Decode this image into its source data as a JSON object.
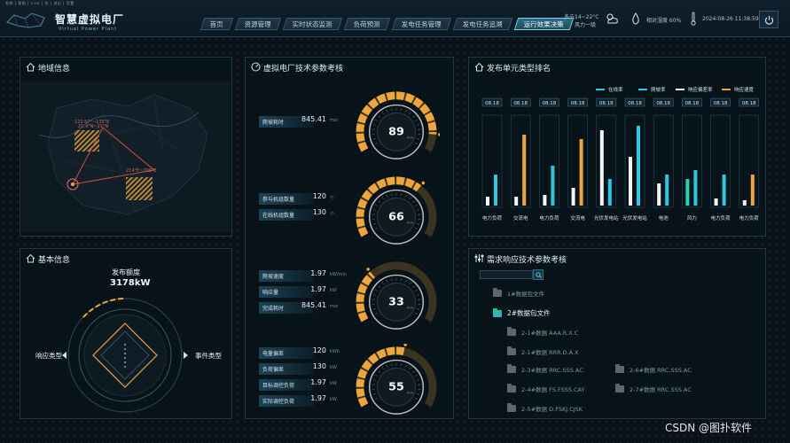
{
  "system_bar": "系统 | 帮助 | Line | 关 | 退出 | 设置",
  "app": {
    "title": "智慧虚拟电厂",
    "subtitle": "Virtual Power Plant"
  },
  "nav": [
    {
      "label": "首页",
      "active": false
    },
    {
      "label": "资源管理",
      "active": false
    },
    {
      "label": "实时状态监测",
      "active": false
    },
    {
      "label": "负荷预测",
      "active": false
    },
    {
      "label": "发电任务管理",
      "active": false
    },
    {
      "label": "发电任务追溯",
      "active": false
    },
    {
      "label": "运行效果决策",
      "active": true
    }
  ],
  "status": {
    "weather_line1": "多云14~22°C",
    "weather_line2": "风力一级",
    "humidity": "相对湿度 60%",
    "datetime": "2024-08-26 11:38:59"
  },
  "map_panel": {
    "title": "地域信息",
    "labels": [
      "121.57°~135°E",
      "21.4°N~25°N",
      "214°E~290°E"
    ]
  },
  "tech_panel": {
    "title": "虚拟电厂技术参数考核",
    "groups": [
      {
        "gauge": 89,
        "unit": "min",
        "fraction": 0.89,
        "rows": [
          {
            "label": "爬坡耗时",
            "value": "845.41",
            "unit": "min"
          }
        ]
      },
      {
        "gauge": 66,
        "unit": "min",
        "fraction": 0.66,
        "rows": [
          {
            "label": "参与机组数量",
            "value": "120",
            "unit": "个"
          },
          {
            "label": "在线机组数量",
            "value": "130",
            "unit": "个"
          }
        ]
      },
      {
        "gauge": 33,
        "unit": "min",
        "fraction": 0.33,
        "rows": [
          {
            "label": "爬坡速度",
            "value": "1.97",
            "unit": "kW/min"
          },
          {
            "label": "响应量",
            "value": "1.97",
            "unit": "kW"
          },
          {
            "label": "完成耗时",
            "value": "845.41",
            "unit": "min"
          }
        ]
      },
      {
        "gauge": 55,
        "unit": "min",
        "fraction": 0.55,
        "rows": [
          {
            "label": "电量偏差",
            "value": "120",
            "unit": "kWh"
          },
          {
            "label": "负荷偏差",
            "value": "130",
            "unit": "kW"
          },
          {
            "label": "目标调控负荷",
            "value": "1.97",
            "unit": "kW"
          },
          {
            "label": "实际调控负荷",
            "value": "1.97",
            "unit": "kW"
          }
        ]
      }
    ]
  },
  "basic_panel": {
    "title": "基本信息",
    "top_label": "发布额度",
    "top_value": "3178kW",
    "left_label": "响应类型",
    "right_label": "事件类型"
  },
  "colors": {
    "cyan": "#2bc8e0",
    "white": "#f2f6f8",
    "orange": "#f0a53c",
    "green": "#2ad3b0"
  },
  "chart_panel": {
    "title": "发布单元类型排名"
  },
  "chart_data": {
    "type": "bar",
    "legend": [
      "在线率",
      "爬坡率",
      "响应偏差率",
      "响应速度"
    ],
    "legend_placement": "top-right",
    "categories": [
      "电力负荷",
      "交流电",
      "电力负荷",
      "交流电",
      "光伏发电站",
      "光伏发电站",
      "电池",
      "风力",
      "电力负荷",
      "电力负荷"
    ],
    "top_labels": [
      "08.18",
      "08.18",
      "08.18",
      "08.18",
      "08.18",
      "08.18",
      "08.18",
      "08.18",
      "08.18",
      "08.18"
    ],
    "ylim": [
      0,
      100
    ],
    "series": [
      {
        "values": [
          10,
          10,
          12,
          20,
          85,
          55,
          25,
          30,
          8,
          6
        ],
        "color_key": "white"
      },
      {
        "values": [
          35,
          80,
          45,
          75,
          30,
          90,
          35,
          40,
          35,
          35
        ],
        "color_key": "cyan"
      }
    ],
    "bar_colors": [
      [
        "white",
        "cyan"
      ],
      [
        "white",
        "orange"
      ],
      [
        "white",
        "cyan"
      ],
      [
        "white",
        "orange"
      ],
      [
        "white",
        "cyan"
      ],
      [
        "white",
        "cyan"
      ],
      [
        "white",
        "cyan"
      ],
      [
        "green",
        "cyan"
      ],
      [
        "white",
        "cyan"
      ],
      [
        "white",
        "orange"
      ]
    ]
  },
  "tree_panel": {
    "title": "需求响应技术参数考核",
    "items": [
      {
        "label": "1#数据包文件",
        "level": 0,
        "col": 0,
        "open": false,
        "bright": false
      },
      {
        "label": "2#数据包文件",
        "level": 0,
        "col": 0,
        "open": true,
        "bright": true
      },
      {
        "label": "2-1#数据 AAA.R.X.C",
        "level": 1,
        "col": 0,
        "open": false,
        "bright": false
      },
      {
        "label": "2-1#数据 RRR.D.A.X",
        "level": 1,
        "col": 0,
        "open": false,
        "bright": false
      },
      {
        "label": "2-3#数据 RRC.SSS.AC",
        "level": 1,
        "col": 0,
        "open": false,
        "bright": false
      },
      {
        "label": "2-6#数据 RRC.SSS.AC",
        "level": 1,
        "col": 1,
        "open": false,
        "bright": false
      },
      {
        "label": "2-4#数据 FS.FSSS.CAY",
        "level": 1,
        "col": 0,
        "open": false,
        "bright": false
      },
      {
        "label": "2-7#数据 RRC.SSS.AC",
        "level": 1,
        "col": 1,
        "open": false,
        "bright": false
      },
      {
        "label": "2-5#数据 D.FSKJ.CJSK",
        "level": 1,
        "col": 0,
        "open": false,
        "bright": false
      }
    ]
  },
  "watermark": "CSDN @图扑软件"
}
